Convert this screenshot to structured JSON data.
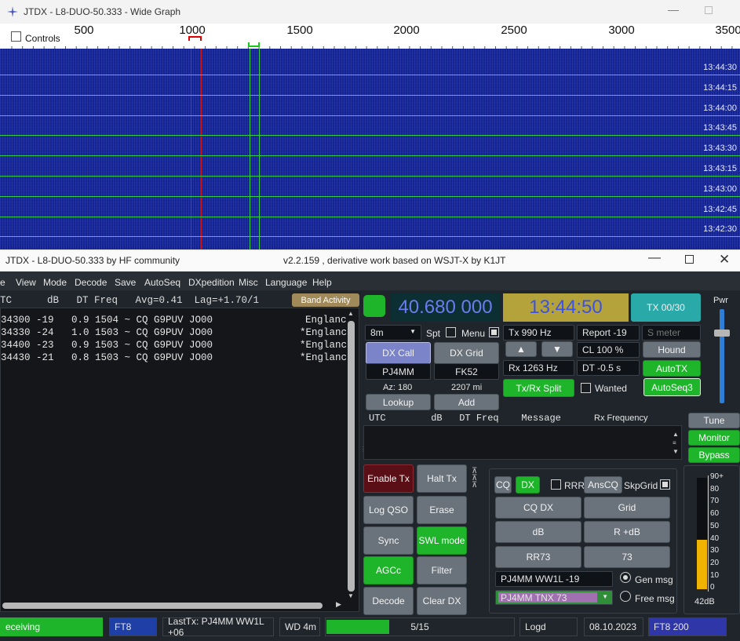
{
  "wide_graph": {
    "title": "JTDX - L8-DUO-50.333 - Wide Graph",
    "controls_label": "Controls",
    "scale_ticks": [
      "500",
      "1000",
      "1500",
      "2000",
      "2500",
      "3000",
      "3500"
    ],
    "timestamps": [
      "13:44:30",
      "13:44:15",
      "13:44:00",
      "13:43:45",
      "13:43:30",
      "13:43:15",
      "13:43:00",
      "13:42:45",
      "13:42:30"
    ]
  },
  "main": {
    "title_left": "JTDX - L8-DUO-50.333  by HF community",
    "title_center": "v2.2.159 , derivative work based on WSJT-X by K1JT",
    "menu": [
      "e",
      "View",
      "Mode",
      "Decode",
      "Save",
      "AutoSeq",
      "DXpedition",
      "Misc",
      "Language",
      "Help"
    ],
    "band_header": "TC      dB   DT Freq   Avg=0.41  Lag=+1.70/1",
    "band_activity_label": "Band Activity",
    "decodes": [
      {
        "text": "34300 -19   0.9 1504 ~ CQ G9PUV JO00",
        "country": "Englanc"
      },
      {
        "text": "34330 -24   1.0 1503 ~ CQ G9PUV JO00",
        "country": "*Englanc"
      },
      {
        "text": "34400 -23   0.9 1503 ~ CQ G9PUV JO00",
        "country": "*Englanc"
      },
      {
        "text": "34430 -21   0.8 1503 ~ CQ G9PUV JO00",
        "country": "*Englanc"
      }
    ],
    "rx_header": "UTC        dB   DT Freq    Message",
    "rx_frequency_label": "Rx Frequency"
  },
  "controls": {
    "frequency": "40.680 000",
    "clock": "13:44:50",
    "tx_counter": "TX 00/30",
    "pwr_label": "Pwr",
    "band": "8m",
    "spt": "Spt",
    "menu": "Menu",
    "dx_call_btn": "DX Call",
    "dx_grid_btn": "DX Grid",
    "dx_call": "PJ4MM",
    "dx_grid": "FK52",
    "az": "Az: 180",
    "dist": "2207 mi",
    "lookup": "Lookup",
    "add": "Add",
    "tx_freq": "Tx  990  Hz",
    "rx_freq": "Rx  1263  Hz",
    "report": "Report -19",
    "cl": "CL  100 %",
    "dt": "DT -0.5 s",
    "s_meter": "S meter",
    "hound": "Hound",
    "autotx": "AutoTX",
    "autoseq3": "AutoSeq3",
    "txrx_split": "Tx/Rx Split",
    "wanted": "Wanted",
    "tune": "Tune",
    "monitor": "Monitor",
    "bypass": "Bypass",
    "enable_tx": "Enable Tx",
    "halt_tx": "Halt Tx",
    "log_qso": "Log QSO",
    "erase": "Erase",
    "sync": "Sync",
    "swl_mode": "SWL mode",
    "agcc": "AGCc",
    "filter": "Filter",
    "decode": "Decode",
    "clear_dx": "Clear DX",
    "cq": "CQ",
    "dx": "DX",
    "rrr": "RRR",
    "anscq": "AnsCQ",
    "skpgrid": "SkpGrid",
    "cq_dx": "CQ DX",
    "grid": "Grid",
    "db": "dB",
    "r_db": "R +dB",
    "rr73": "RR73",
    "n73": "73",
    "gen_msg_text": "PJ4MM WW1L -19",
    "free_msg_text": "PJ4MM TNX 73",
    "gen_msg": "Gen msg",
    "free_msg": "Free msg",
    "db_readout": "42dB",
    "meter_scale": [
      "90+",
      "80",
      "70",
      "60",
      "50",
      "40",
      "30",
      "20",
      "10",
      "0"
    ],
    "meter_level_db": 42
  },
  "status": {
    "mode_state": "eceiving",
    "mode": "FT8",
    "last_tx": "LastTx: PJ4MM WW1L +06",
    "wd": "WD 4m",
    "progress": "5/15",
    "progress_fraction": 0.333,
    "logd": "Logd",
    "date": "08.10.2023",
    "ft8_200": "FT8  200"
  },
  "colors": {
    "waterfall": "#1c2a96",
    "green": "#1eb52b",
    "freq_bg": "#0c2f33",
    "freq_fg": "#6a7cf0",
    "clock_bg": "#b4a23a"
  }
}
